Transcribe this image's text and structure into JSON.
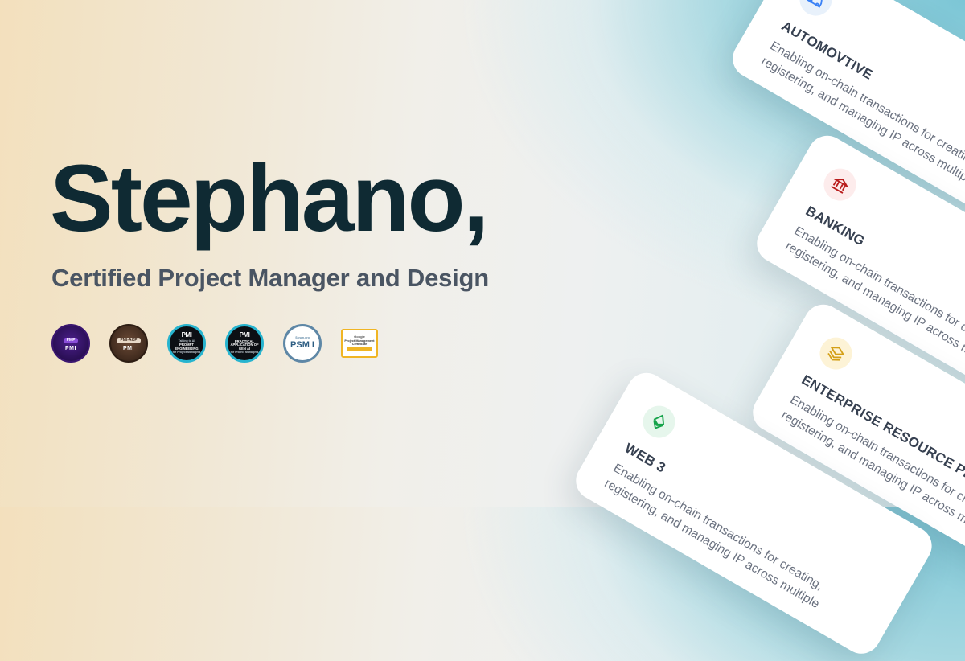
{
  "hero": {
    "name": "Stephano,",
    "subtitle": "Certified Project Manager and Design"
  },
  "badges": {
    "pmp": {
      "label": "PMP",
      "issuer": "PMI"
    },
    "pmi_acp": {
      "label": "PMI-ACP",
      "issuer": "PMI"
    },
    "prompt_engineering": {
      "mark": "PMI",
      "top": "Talking to AI",
      "title": "PROMPT ENGINEERING",
      "sub": "for Project Managers"
    },
    "gen_ai": {
      "mark": "PMI",
      "title": "PRACTICAL APPLICATION OF GEN AI",
      "sub": "for Project Managers"
    },
    "psm": {
      "org": "Scrum.org",
      "label": "PSM I"
    },
    "google": {
      "org": "Google",
      "title": "Project Management Certificate"
    }
  },
  "cards": [
    {
      "id": "automotive",
      "title": "AUTOMOVTIVE",
      "desc": "Enabling on-chain transactions for creating, registering, and managing IP across multiple",
      "icon": "car-icon",
      "icon_bg": "#e8f1fb",
      "icon_color": "#3b82f6"
    },
    {
      "id": "banking",
      "title": "BANKING",
      "desc": "Enabling on-chain transactions for creating, registering, and managing IP across multiple",
      "icon": "bank-icon",
      "icon_bg": "#fdecec",
      "icon_color": "#b91c1c"
    },
    {
      "id": "erp",
      "title": "ENTERPRISE RESOURCE PLANNING",
      "desc": "Enabling on-chain transactions for creating, registering, and managing IP across multiple",
      "icon": "layers-icon",
      "icon_bg": "#fdf3d6",
      "icon_color": "#d4a017"
    },
    {
      "id": "web3",
      "title": "WEB 3",
      "desc": "Enabling on-chain transactions for creating, registering, and managing IP across multiple",
      "icon": "ethereum-icon",
      "icon_bg": "#e6f6ec",
      "icon_color": "#16a34a"
    }
  ]
}
